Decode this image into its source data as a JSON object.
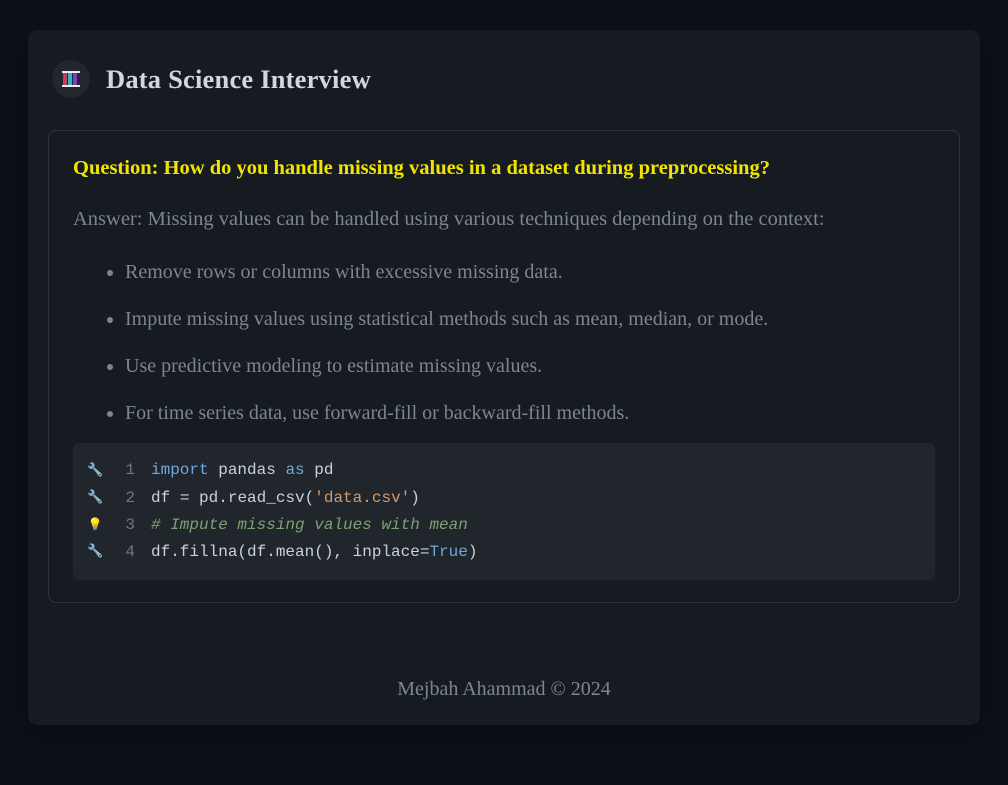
{
  "header": {
    "title": "Data Science Interview"
  },
  "question": {
    "prefix": "Question:",
    "text": "How do you handle missing values in a dataset during preprocessing?"
  },
  "answer": {
    "prefix": "Answer:",
    "intro": "Missing values can be handled using various techniques depending on the context:",
    "items": [
      "Remove rows or columns with excessive missing data.",
      "Impute missing values using statistical methods such as mean, median, or mode.",
      "Use predictive modeling to estimate missing values.",
      "For time series data, use forward-fill or backward-fill methods."
    ]
  },
  "code": {
    "lines": [
      {
        "n": "1",
        "icon": "wrench",
        "tokens": [
          [
            "kw",
            "import"
          ],
          [
            "sp",
            " "
          ],
          [
            "id",
            "pandas"
          ],
          [
            "sp",
            " "
          ],
          [
            "kw",
            "as"
          ],
          [
            "sp",
            " "
          ],
          [
            "id",
            "pd"
          ]
        ]
      },
      {
        "n": "2",
        "icon": "wrench",
        "tokens": [
          [
            "id",
            "df"
          ],
          [
            "sp",
            " "
          ],
          [
            "punc",
            "="
          ],
          [
            "sp",
            " "
          ],
          [
            "id",
            "pd.read_csv("
          ],
          [
            "str",
            "'data.csv'"
          ],
          [
            "id",
            ")"
          ]
        ]
      },
      {
        "n": "3",
        "icon": "bulb",
        "tokens": [
          [
            "cmt",
            "# Impute missing values with mean"
          ]
        ]
      },
      {
        "n": "4",
        "icon": "wrench",
        "tokens": [
          [
            "id",
            "df.fillna(df.mean(),"
          ],
          [
            "sp",
            " "
          ],
          [
            "id",
            "inplace="
          ],
          [
            "bool",
            "True"
          ],
          [
            "id",
            ")"
          ]
        ]
      }
    ]
  },
  "footer": "Mejbah Ahammad © 2024"
}
